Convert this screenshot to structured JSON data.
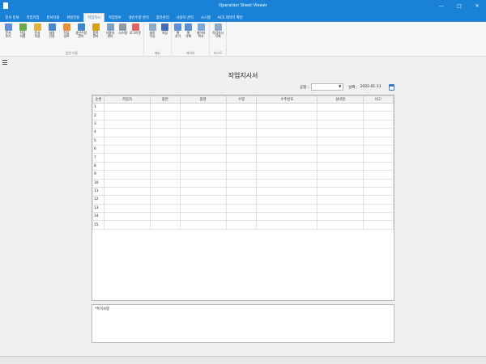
{
  "window": {
    "title": "Operation Sheet Viewer"
  },
  "menu": {
    "tabs": [
      "문서 분류",
      "작업지침",
      "문서지정",
      "파일전송",
      "작업지시",
      "작업일보",
      "생산수량 관리",
      "품목관리",
      "사용자 관리",
      "시스템",
      "ACS 데이터 확인"
    ],
    "active": "작업지시"
  },
  "ribbon": {
    "groups": [
      {
        "label": "일반 이동",
        "buttons": [
          {
            "label": "문서\n보기",
            "icon": "doc-view-icon",
            "color": "#5b8fd6"
          },
          {
            "label": "작업\n지침",
            "icon": "guide-icon",
            "color": "#6aa84f"
          },
          {
            "label": "문서\n지정",
            "icon": "doc-assign-icon",
            "color": "#e0b040"
          },
          {
            "label": "파일\n전송",
            "icon": "file-send-icon",
            "color": "#4a86c8"
          },
          {
            "label": "작업\n일보",
            "icon": "daily-report-icon",
            "color": "#e69138"
          },
          {
            "label": "생산수량\n관리",
            "icon": "production-icon",
            "color": "#3d85c6"
          },
          {
            "label": "품목\n관리",
            "icon": "item-icon",
            "color": "#d4a017"
          },
          {
            "label": "사용자\n관리",
            "icon": "user-icon",
            "color": "#7f9fbf"
          },
          {
            "label": "시스템",
            "icon": "gear-icon",
            "color": "#8e9aa6"
          },
          {
            "label": "로그아웃",
            "icon": "logout-icon",
            "color": "#e06666"
          }
        ]
      },
      {
        "label": "메뉴",
        "buttons": [
          {
            "label": "새로\n작성",
            "icon": "new-doc-icon",
            "color": "#8fa9c9"
          },
          {
            "label": "저장",
            "icon": "save-icon",
            "color": "#3d6fb6"
          }
        ]
      },
      {
        "label": "데이터",
        "buttons": [
          {
            "label": "행\n추가",
            "icon": "add-row-icon",
            "color": "#5b8fd6"
          },
          {
            "label": "행\n삭제",
            "icon": "delete-row-icon",
            "color": "#5b8fd6"
          },
          {
            "label": "데이터\n복사",
            "icon": "copy-data-icon",
            "color": "#7fa8d8"
          }
        ]
      },
      {
        "label": "리스트",
        "buttons": [
          {
            "label": "작업지시\n삭제",
            "icon": "delete-order-icon",
            "color": "#8fa9c9"
          }
        ]
      }
    ]
  },
  "page": {
    "title": "작업지시서",
    "process_label": "공정 :",
    "process_value": "",
    "date_label": "날짜 :",
    "date_value": "2022-01-11"
  },
  "grid": {
    "columns": [
      "순번",
      "작업지",
      "품번",
      "품명",
      "수량",
      "수주번호",
      "설비명",
      "비고"
    ],
    "rows": [
      "1",
      "2",
      "3",
      "4",
      "5",
      "6",
      "7",
      "8",
      "9",
      "10",
      "11",
      "12",
      "13",
      "14",
      "15"
    ]
  },
  "memo": {
    "text": "*특이사항"
  }
}
